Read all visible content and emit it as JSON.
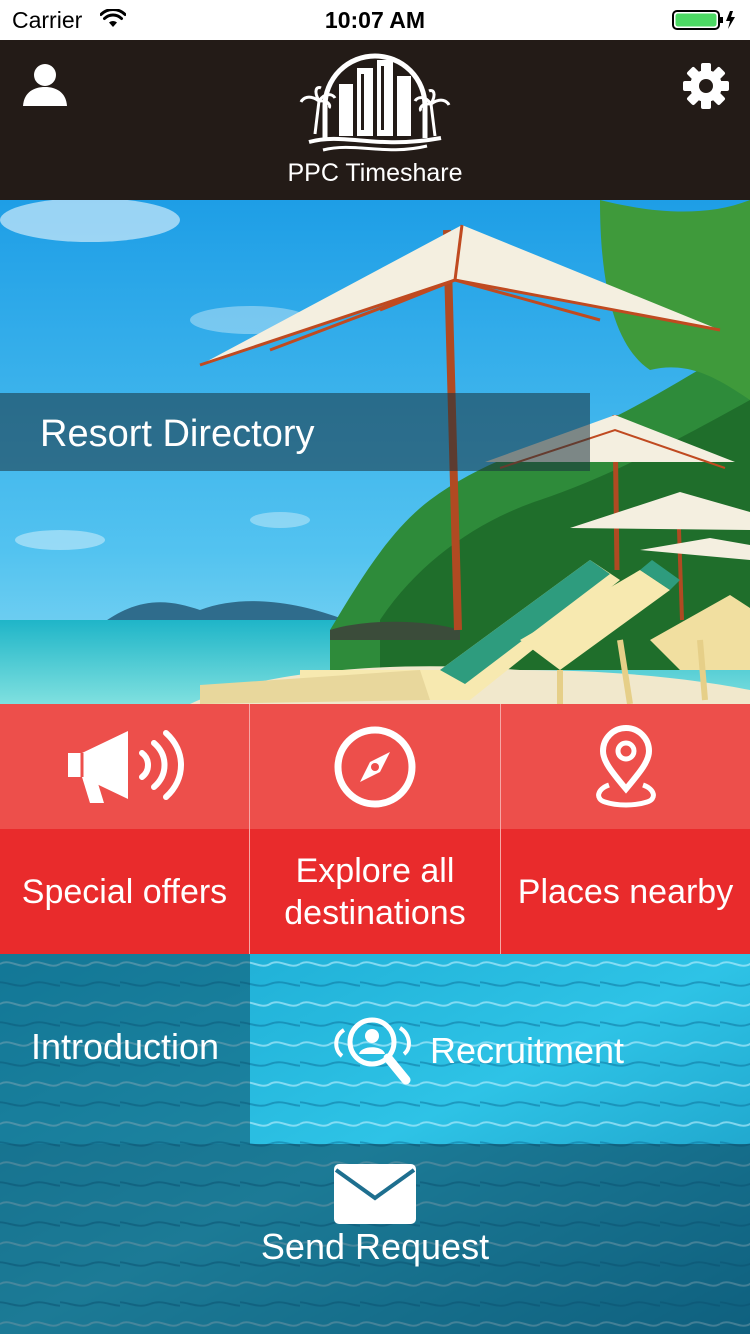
{
  "status_bar": {
    "carrier": "Carrier",
    "time": "10:07 AM",
    "battery_level": 1.0,
    "battery_color": "#4cd964"
  },
  "header": {
    "brand": "PPC Timeshare",
    "background": "#231b17",
    "user_icon": "user-icon",
    "settings_icon": "gear-icon"
  },
  "hero": {
    "title": "Resort Directory"
  },
  "features": [
    {
      "label": "Special offers",
      "icon": "megaphone-icon"
    },
    {
      "label": "Explore all destinations",
      "icon": "compass-icon"
    },
    {
      "label": "Places nearby",
      "icon": "map-pin-icon"
    }
  ],
  "colors": {
    "tile_top": "#ed4f4b",
    "tile_bottom": "#e92b2c"
  },
  "pool_menu": {
    "introduction": "Introduction",
    "recruitment": "Recruitment",
    "recruitment_icon": "recruitment-search-icon",
    "send_request": "Send Request",
    "send_request_icon": "envelope-icon"
  }
}
